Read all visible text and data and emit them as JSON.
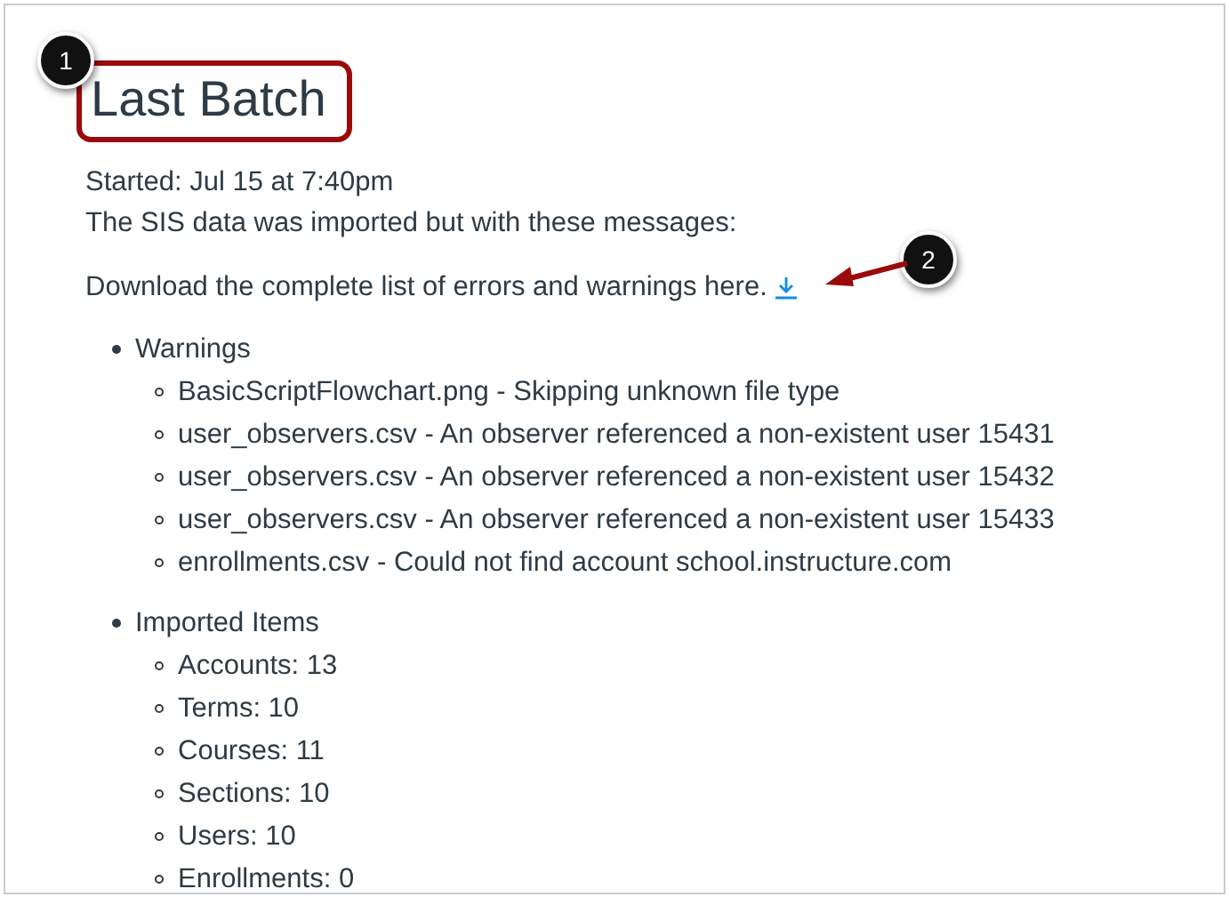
{
  "title": "Last Batch",
  "started": "Started: Jul 15 at 7:40pm",
  "message": "The SIS data was imported but with these messages:",
  "download_text": "Download the complete list of errors and warnings here.",
  "sections": [
    {
      "heading": "Warnings",
      "items": [
        "BasicScriptFlowchart.png - Skipping unknown file type",
        "user_observers.csv - An observer referenced a non-existent user 15431",
        "user_observers.csv - An observer referenced a non-existent user 15432",
        "user_observers.csv - An observer referenced a non-existent user 15433",
        "enrollments.csv - Could not find account school.instructure.com"
      ]
    },
    {
      "heading": "Imported Items",
      "items": [
        "Accounts: 13",
        "Terms: 10",
        "Courses: 11",
        "Sections: 10",
        "Users: 10",
        "Enrollments: 0"
      ]
    }
  ],
  "callouts": [
    "1",
    "2"
  ]
}
